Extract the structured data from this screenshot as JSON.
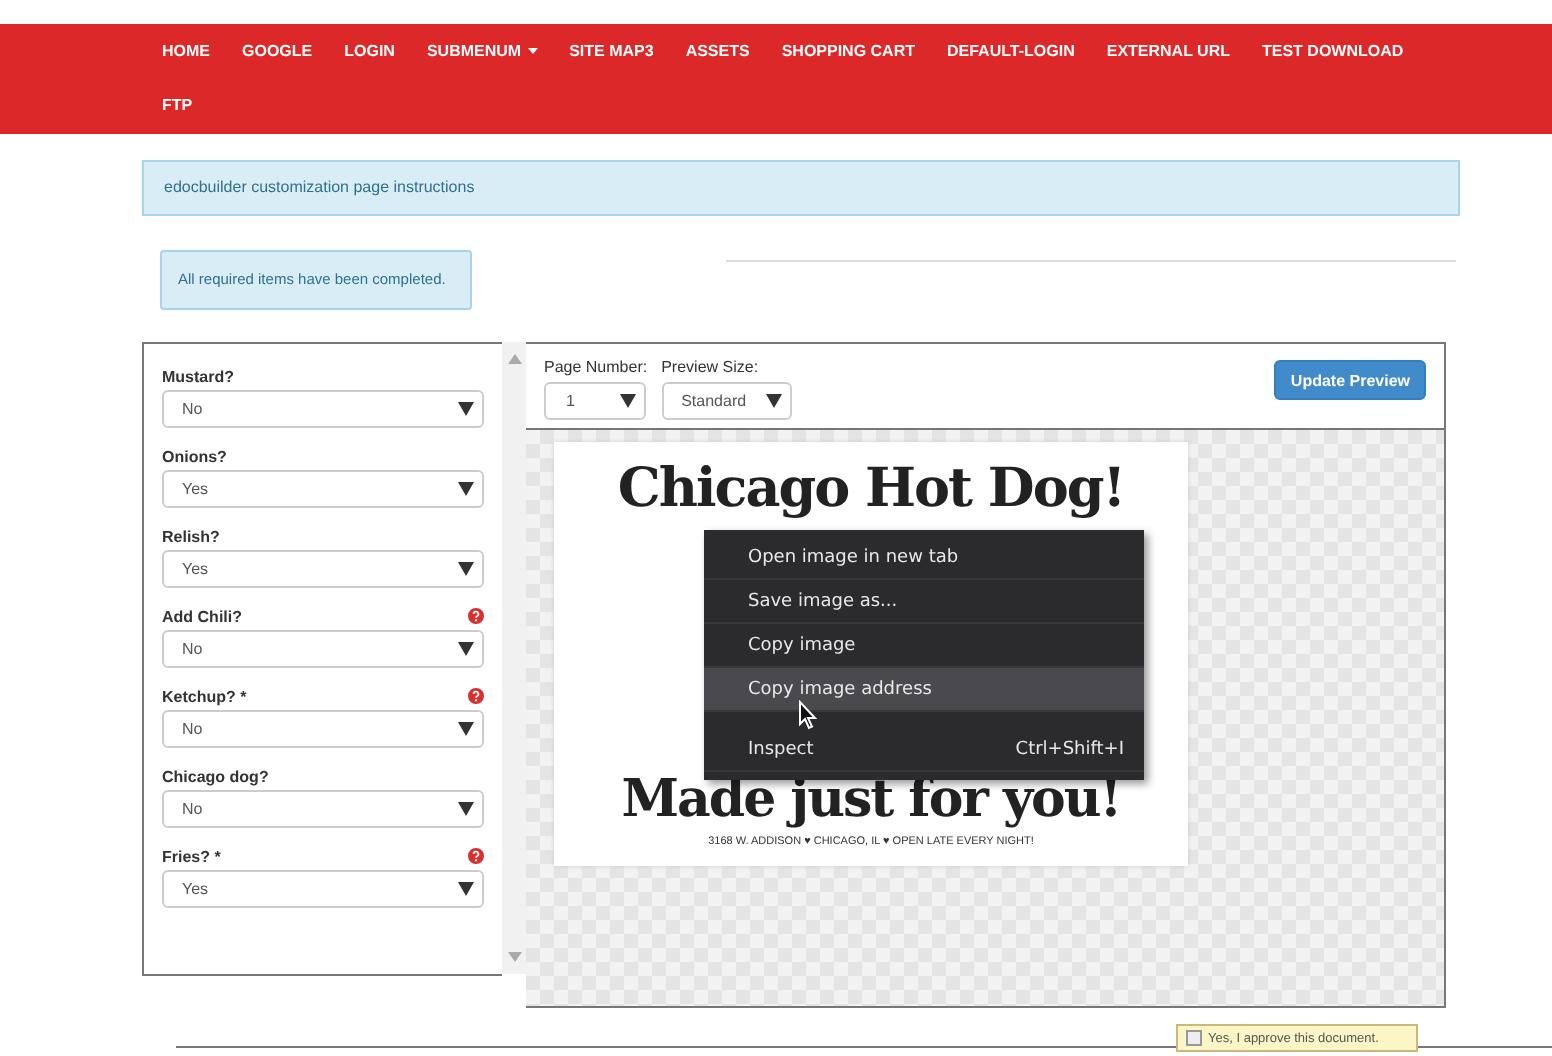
{
  "navbar": {
    "items": [
      {
        "label": "HOME",
        "has_caret": false
      },
      {
        "label": "GOOGLE",
        "has_caret": false
      },
      {
        "label": "LOGIN",
        "has_caret": false
      },
      {
        "label": "SUBMENUM",
        "has_caret": true
      },
      {
        "label": "SITE MAP3",
        "has_caret": false
      },
      {
        "label": "ASSETS",
        "has_caret": false
      },
      {
        "label": "SHOPPING CART",
        "has_caret": false
      },
      {
        "label": "DEFAULT-LOGIN",
        "has_caret": false
      },
      {
        "label": "EXTERNAL URL",
        "has_caret": false
      },
      {
        "label": "TEST DOWNLOAD",
        "has_caret": false
      },
      {
        "label": "FTP",
        "has_caret": false
      }
    ]
  },
  "instructions": "edocbuilder customization page instructions",
  "status_alert": "All required items have been completed.",
  "form": {
    "fields": [
      {
        "label": "Mustard?",
        "value": "No",
        "help": false
      },
      {
        "label": "Onions?",
        "value": "Yes",
        "help": false
      },
      {
        "label": "Relish?",
        "value": "Yes",
        "help": false
      },
      {
        "label": "Add Chili?",
        "value": "No",
        "help": true
      },
      {
        "label": "Ketchup? *",
        "value": "No",
        "help": true
      },
      {
        "label": "Chicago dog?",
        "value": "No",
        "help": false
      },
      {
        "label": "Fries? *",
        "value": "Yes",
        "help": true
      }
    ]
  },
  "preview": {
    "page_number": {
      "label": "Page Number:",
      "value": "1"
    },
    "preview_size": {
      "label": "Preview Size:",
      "value": "Standard"
    },
    "update_button": "Update Preview",
    "document": {
      "headline": "Chicago Hot Dog!",
      "tagline": "Made just for you!",
      "footer": "3168 W. ADDISON ♥ CHICAGO, IL ♥ OPEN LATE EVERY NIGHT!"
    }
  },
  "context_menu": {
    "groups": [
      [
        {
          "label": "Open image in new tab",
          "selected": false
        },
        {
          "label": "Save image as...",
          "selected": false
        },
        {
          "label": "Copy image",
          "selected": false
        },
        {
          "label": "Copy image address",
          "selected": true
        }
      ],
      [
        {
          "label": "Inspect",
          "shortcut": "Ctrl+Shift+I",
          "selected": false
        }
      ]
    ]
  },
  "approval": {
    "label": "Yes, I approve this document.",
    "checked": false
  }
}
